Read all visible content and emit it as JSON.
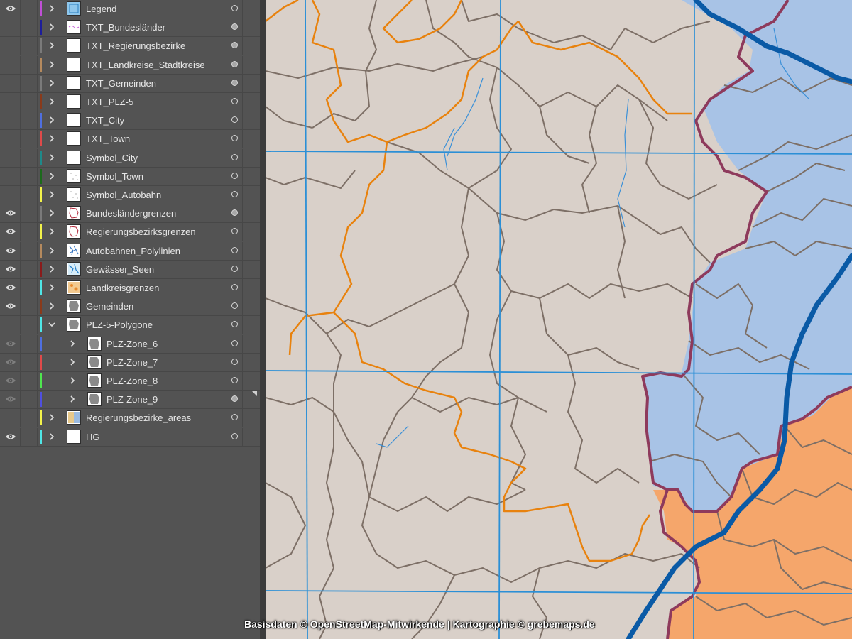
{
  "layers": [
    {
      "name": "Legend",
      "color": "#c04fd6",
      "visible": true,
      "expanded": false,
      "level": 0,
      "target_filled": false,
      "thumb": "legend"
    },
    {
      "name": "TXT_Bundesländer",
      "color": "#1d1d9a",
      "visible": false,
      "expanded": false,
      "level": 0,
      "target_filled": true,
      "thumb": "lines"
    },
    {
      "name": "TXT_Regierungsbezirke",
      "color": "#7a7a7a",
      "visible": false,
      "expanded": false,
      "level": 0,
      "target_filled": true,
      "thumb": "blank"
    },
    {
      "name": "TXT_Landkreise_Stadtkreise",
      "color": "#b58a5e",
      "visible": false,
      "expanded": false,
      "level": 0,
      "target_filled": true,
      "thumb": "blank"
    },
    {
      "name": "TXT_Gemeinden",
      "color": "#7a7a7a",
      "visible": false,
      "expanded": false,
      "level": 0,
      "target_filled": true,
      "thumb": "blank"
    },
    {
      "name": "TXT_PLZ-5",
      "color": "#8a3a1a",
      "visible": false,
      "expanded": false,
      "level": 0,
      "target_filled": false,
      "thumb": "blank"
    },
    {
      "name": "TXT_City",
      "color": "#4f6fe0",
      "visible": false,
      "expanded": false,
      "level": 0,
      "target_filled": false,
      "thumb": "blank"
    },
    {
      "name": "TXT_Town",
      "color": "#e04a4a",
      "visible": false,
      "expanded": false,
      "level": 0,
      "target_filled": false,
      "thumb": "blank"
    },
    {
      "name": "Symbol_City",
      "color": "#1e8a8a",
      "visible": false,
      "expanded": false,
      "level": 0,
      "target_filled": false,
      "thumb": "blank"
    },
    {
      "name": "Symbol_Town",
      "color": "#1c6a1c",
      "visible": false,
      "expanded": false,
      "level": 0,
      "target_filled": false,
      "thumb": "dots"
    },
    {
      "name": "Symbol_Autobahn",
      "color": "#f2f24a",
      "visible": false,
      "expanded": false,
      "level": 0,
      "target_filled": false,
      "thumb": "dots"
    },
    {
      "name": "Bundesländergrenzen",
      "color": "#7a7a7a",
      "visible": true,
      "expanded": false,
      "level": 0,
      "target_filled": true,
      "thumb": "redmap"
    },
    {
      "name": "Regierungsbezirksgrenzen",
      "color": "#f2f24a",
      "visible": true,
      "expanded": false,
      "level": 0,
      "target_filled": false,
      "thumb": "redmap"
    },
    {
      "name": "Autobahnen_Polylinien",
      "color": "#b58a5e",
      "visible": true,
      "expanded": false,
      "level": 0,
      "target_filled": false,
      "thumb": "bluemap"
    },
    {
      "name": "Gewässer_Seen",
      "color": "#8a1a1a",
      "visible": true,
      "expanded": false,
      "level": 0,
      "target_filled": false,
      "thumb": "water"
    },
    {
      "name": "Landkreisgrenzen",
      "color": "#4fe6e6",
      "visible": true,
      "expanded": false,
      "level": 0,
      "target_filled": false,
      "thumb": "orangemap"
    },
    {
      "name": "Gemeinden",
      "color": "#8a3a1a",
      "visible": true,
      "expanded": false,
      "level": 0,
      "target_filled": false,
      "thumb": "graymap"
    },
    {
      "name": "PLZ-5-Polygone",
      "color": "#4fe6e6",
      "visible": false,
      "expanded": true,
      "level": 0,
      "target_filled": false,
      "thumb": "graymap"
    },
    {
      "name": "PLZ-Zone_6",
      "color": "#4f6fe0",
      "visible": true,
      "dim_eye": true,
      "expanded": false,
      "level": 1,
      "target_filled": false,
      "thumb": "graymap"
    },
    {
      "name": "PLZ-Zone_7",
      "color": "#e04a4a",
      "visible": true,
      "dim_eye": true,
      "expanded": false,
      "level": 1,
      "target_filled": false,
      "thumb": "graymap"
    },
    {
      "name": "PLZ-Zone_8",
      "color": "#4fe64f",
      "visible": true,
      "dim_eye": true,
      "expanded": false,
      "level": 1,
      "target_filled": false,
      "thumb": "graymap"
    },
    {
      "name": "PLZ-Zone_9",
      "color": "#4f4fe0",
      "visible": true,
      "dim_eye": true,
      "expanded": false,
      "level": 1,
      "target_filled": true,
      "thumb": "graymap"
    },
    {
      "name": "Regierungsbezirke_areas",
      "color": "#f2f24a",
      "visible": false,
      "expanded": false,
      "level": 0,
      "target_filled": false,
      "thumb": "areas"
    },
    {
      "name": "HG",
      "color": "#4fe6e6",
      "visible": true,
      "expanded": false,
      "level": 0,
      "target_filled": false,
      "thumb": "blank"
    }
  ],
  "map": {
    "background_color": "#d9d0c9",
    "blue_region_color": "#a8c3e6",
    "orange_region_color": "#f5a66b",
    "credit": "Basisdaten © OpenStreetMap-Mitwirkende | Kartographie © grebemaps.de"
  }
}
